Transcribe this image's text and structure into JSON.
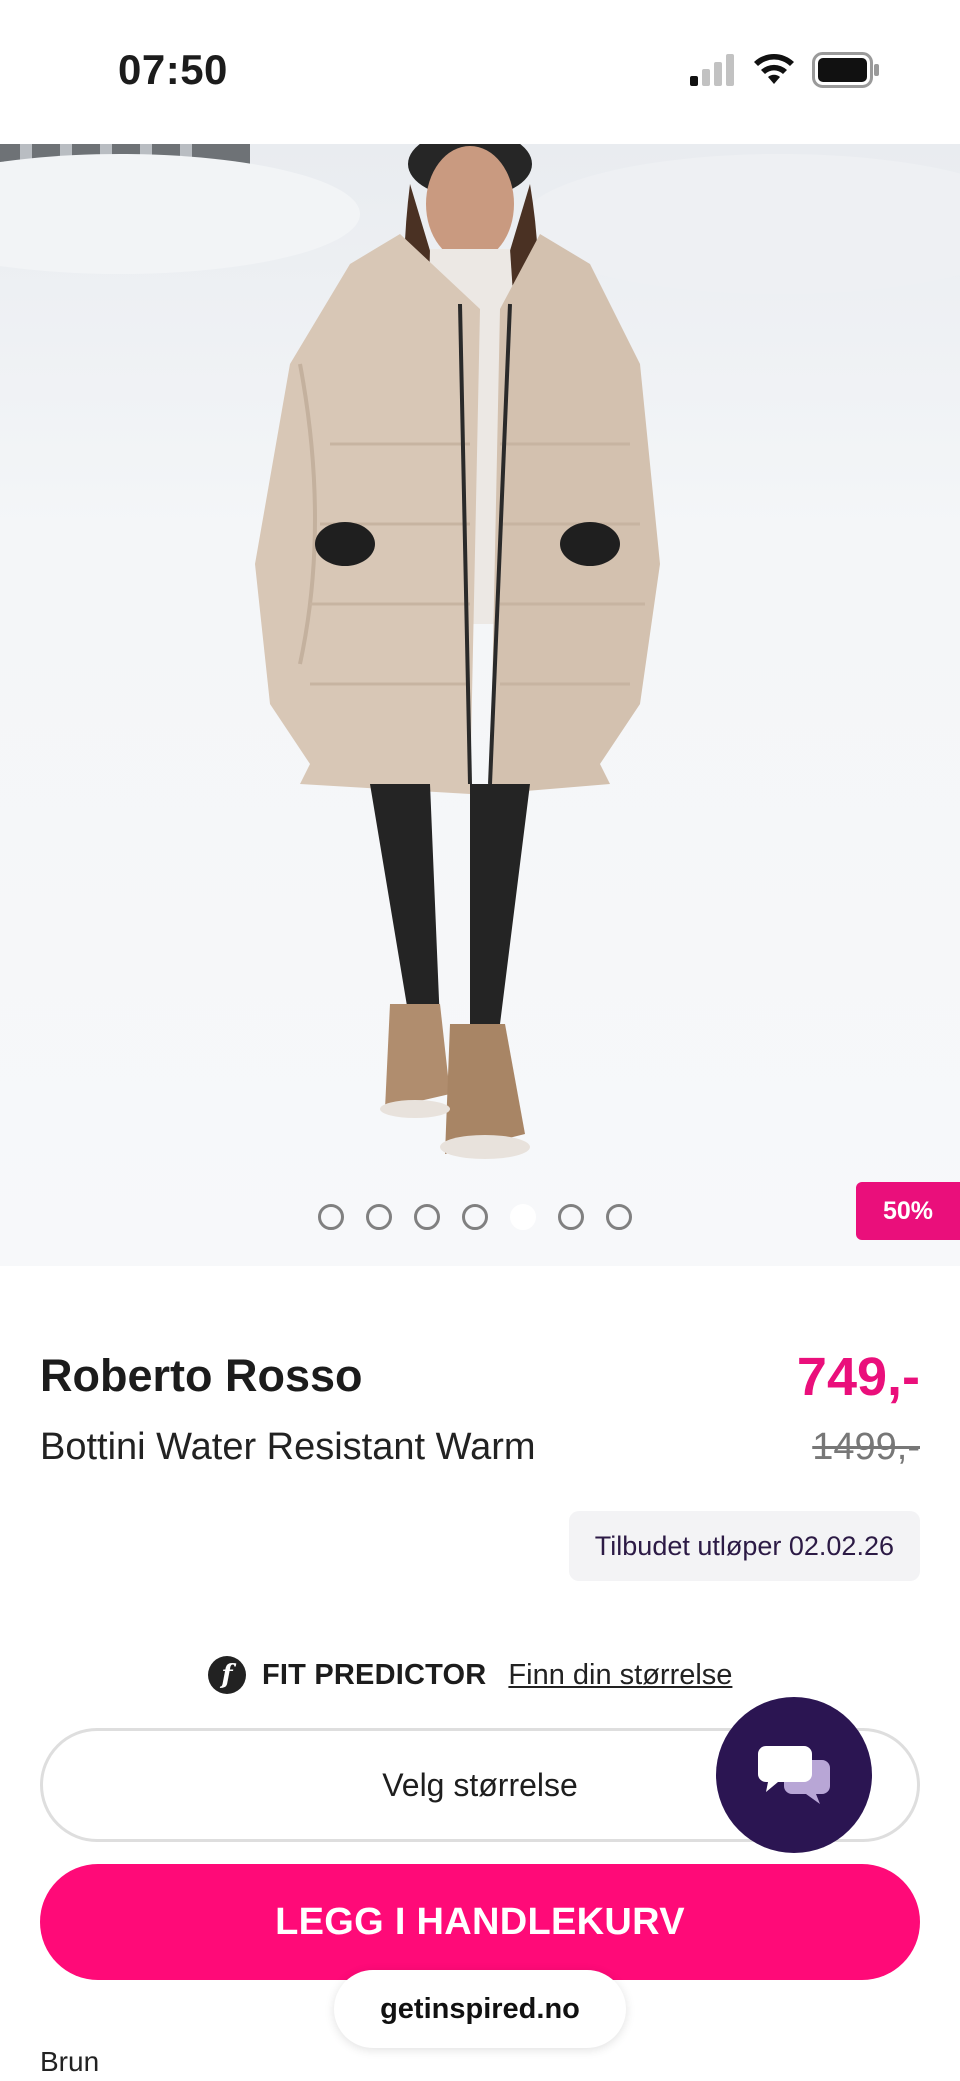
{
  "status_bar": {
    "time": "07:50"
  },
  "hero": {
    "image_alt": "Woman in beige puffer coat and brown winter boots walking in snow",
    "carousel": {
      "total": 7,
      "active_index": 4
    },
    "discount_badge": "50%"
  },
  "product": {
    "brand": "Roberto Rosso",
    "name": "Bottini Water Resistant Warm",
    "price": "749,-",
    "original_price": "1499,-",
    "offer_expiry": "Tilbudet utløper 02.02.26",
    "color": "Brun"
  },
  "fit_predictor": {
    "label": "FIT PREDICTOR",
    "link": "Finn din størrelse",
    "icon_letter": "f"
  },
  "actions": {
    "size_select": "Velg størrelse",
    "add_to_cart": "LEGG I HANDLEKURV"
  },
  "browser": {
    "url": "getinspired.no"
  },
  "colors": {
    "accent": "#ea0f7b",
    "cart_button": "#ff0a78",
    "chat_bubble": "#2b1552"
  }
}
